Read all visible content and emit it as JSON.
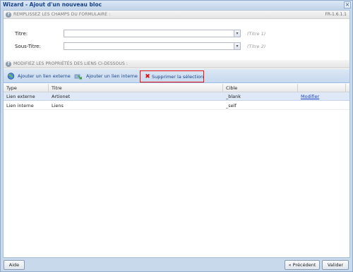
{
  "window": {
    "title": "Wizard - Ajout d'un nouveau bloc",
    "close_icon": "×"
  },
  "section1": {
    "icon": "?",
    "title": "REMPLISSEZ LES CHAMPS DU FORMULAIRE :",
    "version": "FR-1.6.1.1"
  },
  "form": {
    "fields": [
      {
        "label": "Titre:",
        "value": "",
        "hint": "(Titre 1)"
      },
      {
        "label": "Sous-Titre:",
        "value": "",
        "hint": "(Titre 2)"
      }
    ],
    "dropdown_icon": "▾"
  },
  "section2": {
    "icon": "?",
    "title": "MODIFIEZ LES PROPRIÉTÉS DES LIENS CI-DESSOUS :"
  },
  "toolbar": {
    "add_external_label": "Ajouter un lien externe",
    "add_internal_label": "Ajouter un lien interne",
    "delete_label": "Supprimer la sélection"
  },
  "grid": {
    "columns": [
      "Type",
      "Titre",
      "Cible",
      "",
      ""
    ],
    "rows": [
      {
        "type": "Lien externe",
        "titre": "Artionet",
        "cible": "_blank",
        "action": "Modifier"
      },
      {
        "type": "Lien interne",
        "titre": "Liens",
        "cible": "_self",
        "action": ""
      }
    ]
  },
  "footer": {
    "help_label": "Aide",
    "prev_label": "« Précédent",
    "next_label": "Valider"
  },
  "colors": {
    "accent": "#15428b",
    "selection": "#dfe8f6",
    "delete_highlight": "#ee1111"
  }
}
